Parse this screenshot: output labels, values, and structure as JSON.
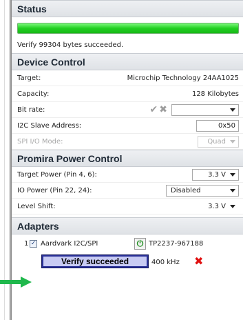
{
  "status": {
    "header": "Status",
    "progress_percent": 100,
    "message": "Verify 99304 bytes succeeded."
  },
  "device_control": {
    "header": "Device Control",
    "target_label": "Target:",
    "target_value": "Microchip Technology 24AA1025",
    "capacity_label": "Capacity:",
    "capacity_value": "128 Kilobytes",
    "bitrate_label": "Bit rate:",
    "bitrate_value": "",
    "i2c_label": "I2C Slave Address:",
    "i2c_value": "0x50",
    "spi_label": "SPI I/O Mode:",
    "spi_value": "Quad"
  },
  "power_control": {
    "header": "Promira Power Control",
    "target_power_label": "Target Power (Pin 4, 6):",
    "target_power_value": "3.3 V",
    "io_power_label": "IO Power (Pin 22, 24):",
    "io_power_value": "Disabled",
    "level_shift_label": "Level Shift:",
    "level_shift_value": "3.3 V"
  },
  "adapters": {
    "header": "Adapters",
    "items": [
      {
        "index": "1",
        "checked": true,
        "name": "Aardvark I2C/SPI",
        "serial": "TP2237-967188",
        "status_text": "Verify succeeded",
        "speed": "400 kHz"
      }
    ]
  },
  "colors": {
    "progress_green": "#22d022",
    "verify_box": "#282f96",
    "error_x": "#e01010",
    "arrow_green": "#1fb84c"
  }
}
